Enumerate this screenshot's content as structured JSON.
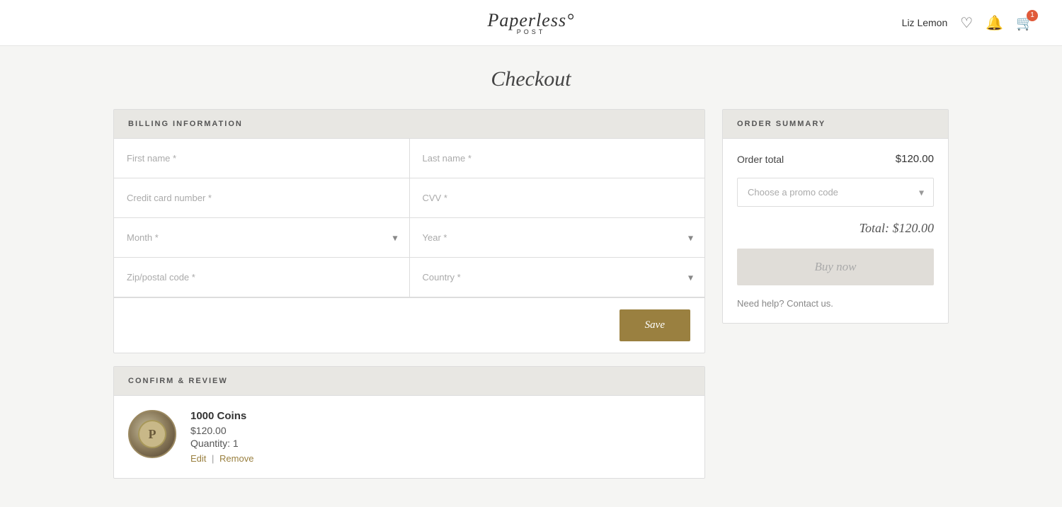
{
  "header": {
    "logo_text": "Paperless°",
    "logo_sub": "POST",
    "username": "Liz Lemon",
    "cart_count": "1"
  },
  "page": {
    "title": "Checkout"
  },
  "billing": {
    "section_title": "BILLING INFORMATION",
    "fields": {
      "first_name_placeholder": "First name *",
      "last_name_placeholder": "Last name *",
      "credit_card_placeholder": "Credit card number *",
      "cvv_placeholder": "CVV *",
      "month_placeholder": "Month *",
      "year_placeholder": "Year *",
      "zip_placeholder": "Zip/postal code *",
      "country_placeholder": "Country *"
    },
    "save_label": "Save"
  },
  "confirm": {
    "section_title": "CONFIRM & REVIEW",
    "product_name": "1000 Coins",
    "product_price": "$120.00",
    "product_qty": "Quantity: 1",
    "edit_label": "Edit",
    "remove_label": "Remove",
    "logo_letter": "P"
  },
  "order_summary": {
    "section_title": "ORDER SUMMARY",
    "order_total_label": "Order total",
    "order_total_value": "$120.00",
    "promo_placeholder": "Choose a promo code",
    "grand_total": "Total: $120.00",
    "buy_now_label": "Buy now",
    "help_text": "Need help?",
    "contact_text": "Contact us."
  }
}
